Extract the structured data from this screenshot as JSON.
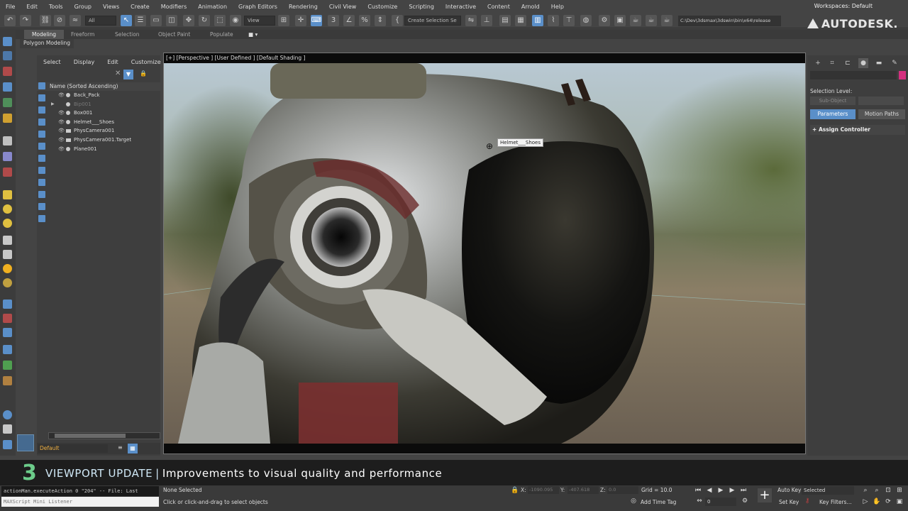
{
  "menu": [
    "File",
    "Edit",
    "Tools",
    "Group",
    "Views",
    "Create",
    "Modifiers",
    "Animation",
    "Graph Editors",
    "Rendering",
    "Civil View",
    "Customize",
    "Scripting",
    "Interactive",
    "Content",
    "Arnold",
    "Help"
  ],
  "workspace": {
    "label": "Workspaces:",
    "value": "Default"
  },
  "toolbar": {
    "filter_select": "All",
    "ref_coord": "View",
    "selection_set": "Create Selection Se",
    "project_path": "C:\\Dev\\3dsmax\\3dswin\\bin\\x64\\release"
  },
  "logo": "AUTODESK.",
  "ribbon": {
    "tabs": [
      "Modeling",
      "Freeform",
      "Selection",
      "Object Paint",
      "Populate"
    ],
    "sub": "Polygon Modeling"
  },
  "explorer": {
    "menu": [
      "Select",
      "Display",
      "Edit",
      "Customize"
    ],
    "header": "Name (Sorted Ascending)",
    "rows": [
      {
        "label": "Back_Pack",
        "dim": false
      },
      {
        "label": "Bip001",
        "dim": true
      },
      {
        "label": "Box001",
        "dim": false
      },
      {
        "label": "Helmet___Shoes",
        "dim": false
      },
      {
        "label": "PhysCamera001",
        "dim": false
      },
      {
        "label": "PhysCamera001.Target",
        "dim": false
      },
      {
        "label": "Plane001",
        "dim": false
      }
    ],
    "layer": "Default"
  },
  "viewport": {
    "label": "[+] [Perspective ] [User Defined ] [Default Shading ]",
    "tooltip": "Helmet___Shoes"
  },
  "command_panel": {
    "selection_level": "Selection Level:",
    "sub_object": "Sub-Object",
    "parameters": "Parameters",
    "motion_paths": "Motion Paths",
    "assign_controller": "Assign Controller"
  },
  "banner": {
    "number": "3",
    "title": "VIEWPORT UPDATE",
    "separator": "|",
    "description": "Improvements to visual quality and performance"
  },
  "status": {
    "script_line": "actionMan.executeAction 0 \"204\"  -- File: Last",
    "listener": "MAXScript Mini Listener",
    "selection": "None Selected",
    "hint": "Click or click-and-drag to select objects",
    "x_label": "X:",
    "x_value": "-1090.095",
    "y_label": "Y:",
    "y_value": "-407.618",
    "z_label": "Z:",
    "z_value": "0.0",
    "grid": "Grid = 10.0",
    "add_time_tag": "Add Time Tag",
    "frame": "0",
    "auto_key": "Auto Key",
    "set_key": "Set Key",
    "key_mode": "Selected",
    "key_filters": "Key Filters..."
  },
  "colors": {
    "accent": "#5a8fc9",
    "banner_number": "#6ccc8a",
    "layer_text": "#f0b040",
    "swatch": "#d4307f"
  }
}
